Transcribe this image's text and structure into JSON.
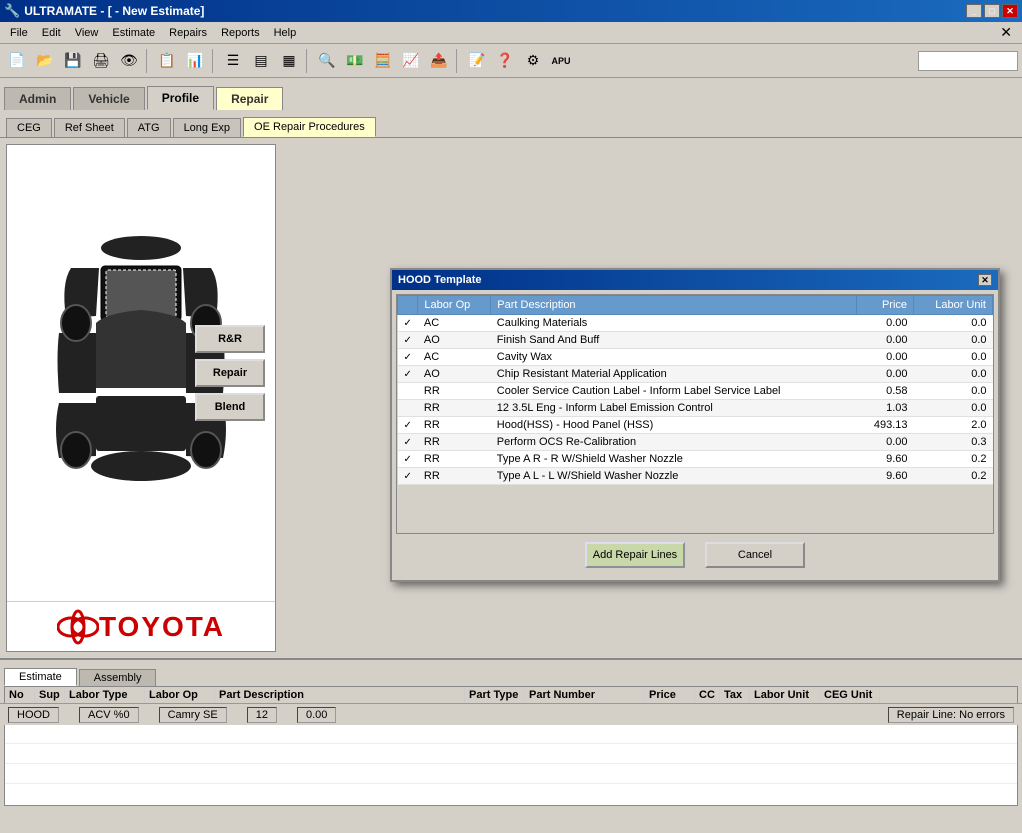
{
  "titleBar": {
    "appName": "ULTRAMATE",
    "docName": "[ - New Estimate]",
    "fullTitle": "ULTRAMATE - [ - New Estimate]"
  },
  "menuBar": {
    "items": [
      "File",
      "Edit",
      "View",
      "Estimate",
      "Repairs",
      "Reports",
      "Help"
    ]
  },
  "navTabs": {
    "items": [
      "Admin",
      "Vehicle",
      "Profile",
      "Repair"
    ],
    "active": "Repair"
  },
  "subTabs": {
    "items": [
      "CEG",
      "Ref Sheet",
      "ATG",
      "Long Exp",
      "OE Repair Procedures"
    ],
    "active": "OE Repair Procedures"
  },
  "repairButtons": {
    "randr": "R&R",
    "repair": "Repair",
    "blend": "Blend"
  },
  "modal": {
    "title": "HOOD Template",
    "tableHeaders": [
      "",
      "Labor Op",
      "Part Description",
      "Price",
      "Labor Unit"
    ],
    "rows": [
      {
        "checked": true,
        "laborOp": "AC",
        "partDesc": "Caulking Materials",
        "price": "0.00",
        "laborUnit": "0.0"
      },
      {
        "checked": true,
        "laborOp": "AO",
        "partDesc": "Finish Sand And Buff",
        "price": "0.00",
        "laborUnit": "0.0"
      },
      {
        "checked": true,
        "laborOp": "AC",
        "partDesc": "Cavity Wax",
        "price": "0.00",
        "laborUnit": "0.0"
      },
      {
        "checked": true,
        "laborOp": "AO",
        "partDesc": "Chip Resistant Material Application",
        "price": "0.00",
        "laborUnit": "0.0"
      },
      {
        "checked": false,
        "laborOp": "RR",
        "partDesc": "Cooler Service Caution Label - Inform Label Service Label",
        "price": "0.58",
        "laborUnit": "0.0"
      },
      {
        "checked": false,
        "laborOp": "RR",
        "partDesc": "12 3.5L Eng - Inform Label Emission Control",
        "price": "1.03",
        "laborUnit": "0.0"
      },
      {
        "checked": true,
        "laborOp": "RR",
        "partDesc": "Hood(HSS) - Hood Panel (HSS)",
        "price": "493.13",
        "laborUnit": "2.0"
      },
      {
        "checked": true,
        "laborOp": "RR",
        "partDesc": "Perform OCS Re-Calibration",
        "price": "0.00",
        "laborUnit": "0.3"
      },
      {
        "checked": true,
        "laborOp": "RR",
        "partDesc": "Type A R - R W/Shield Washer Nozzle",
        "price": "9.60",
        "laborUnit": "0.2"
      },
      {
        "checked": true,
        "laborOp": "RR",
        "partDesc": "Type A L - L W/Shield Washer Nozzle",
        "price": "9.60",
        "laborUnit": "0.2"
      }
    ],
    "addBtn": "Add Repair Lines",
    "cancelBtn": "Cancel"
  },
  "toyota": {
    "logo": "🚗",
    "name": "TOYOTA"
  },
  "bottomTabs": {
    "items": [
      "Estimate",
      "Assembly"
    ],
    "active": "Estimate"
  },
  "gridHeaders": {
    "no": "No",
    "sup": "Sup",
    "laborType": "Labor Type",
    "laborOp": "Labor Op",
    "partDesc": "Part Description",
    "partType": "Part Type",
    "partNumber": "Part Number",
    "price": "Price",
    "cc": "CC",
    "tax": "Tax",
    "laborUnit": "Labor Unit",
    "cegUnit": "CEG Unit"
  },
  "statusBar": {
    "left": "HOOD",
    "acv": "ACV %0",
    "vehicle": "Camry SE",
    "year": "12",
    "amount": "0.00",
    "repairLine": "Repair Line: No errors"
  }
}
